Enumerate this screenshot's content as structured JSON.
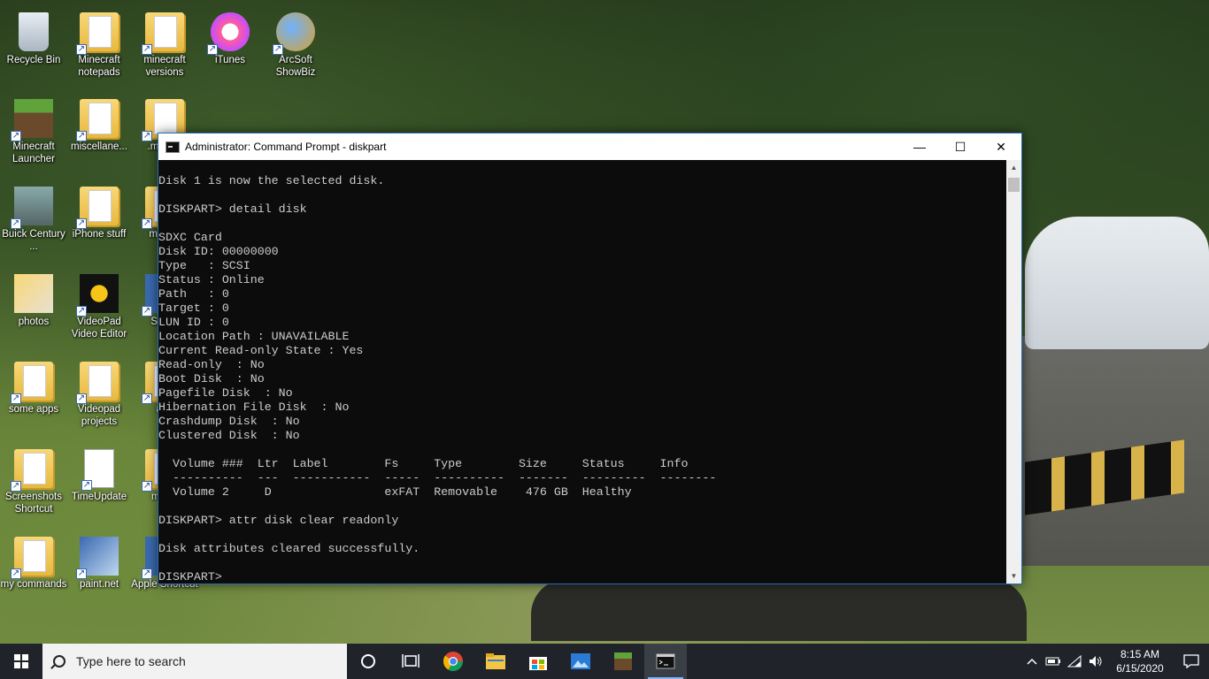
{
  "desktop": {
    "icons": [
      {
        "label": "Recycle Bin",
        "icon": "recycle-bin-icon"
      },
      {
        "label": "Minecraft notepads",
        "icon": "folder-icon"
      },
      {
        "label": "minecraft versions",
        "icon": "folder-icon"
      },
      {
        "label": "iTunes",
        "icon": "itunes-icon"
      },
      {
        "label": "ArcSoft ShowBiz",
        "icon": "arcsoft-icon"
      },
      {
        "label": "Minecraft Launcher",
        "icon": "minecraft-icon"
      },
      {
        "label": "miscellane...",
        "icon": "folder-icon"
      },
      {
        "label": ".min Sh",
        "icon": "folder-icon"
      },
      {
        "label": "Buick Century ...",
        "icon": "photo-icon"
      },
      {
        "label": "iPhone stuff",
        "icon": "folder-icon"
      },
      {
        "label": "mi (SD",
        "icon": "folder-icon"
      },
      {
        "label": "photos",
        "icon": "photos-icon"
      },
      {
        "label": "VideoPad Video Editor",
        "icon": "videopad-icon"
      },
      {
        "label": "S Sou",
        "icon": "app-icon"
      },
      {
        "label": "some apps",
        "icon": "folder-icon"
      },
      {
        "label": "Videopad projects",
        "icon": "folder-icon"
      },
      {
        "label": "aud",
        "icon": "folder-icon"
      },
      {
        "label": "Screenshots Shortcut",
        "icon": "folder-icon"
      },
      {
        "label": "TimeUpdate",
        "icon": "file-icon"
      },
      {
        "label": "mi wo",
        "icon": "folder-icon"
      },
      {
        "label": "my commands",
        "icon": "folder-icon"
      },
      {
        "label": "paint.net",
        "icon": "paintnet-icon"
      },
      {
        "label": "Apple Shortcut",
        "icon": "app-icon"
      }
    ]
  },
  "cmd": {
    "title": "Administrator: Command Prompt - diskpart",
    "minimize": "—",
    "maximize": "☐",
    "close": "✕",
    "lines": [
      "Disk 1 is now the selected disk.",
      "",
      "DISKPART> detail disk",
      "",
      "SDXC Card",
      "Disk ID: 00000000",
      "Type   : SCSI",
      "Status : Online",
      "Path   : 0",
      "Target : 0",
      "LUN ID : 0",
      "Location Path : UNAVAILABLE",
      "Current Read-only State : Yes",
      "Read-only  : No",
      "Boot Disk  : No",
      "Pagefile Disk  : No",
      "Hibernation File Disk  : No",
      "Crashdump Disk  : No",
      "Clustered Disk  : No",
      "",
      "  Volume ###  Ltr  Label        Fs     Type        Size     Status     Info",
      "  ----------  ---  -----------  -----  ----------  -------  ---------  --------",
      "  Volume 2     D                exFAT  Removable    476 GB  Healthy",
      "",
      "DISKPART> attr disk clear readonly",
      "",
      "Disk attributes cleared successfully.",
      "",
      "DISKPART>"
    ]
  },
  "taskbar": {
    "search_placeholder": "Type here to search",
    "time": "8:15 AM",
    "date": "6/15/2020"
  }
}
